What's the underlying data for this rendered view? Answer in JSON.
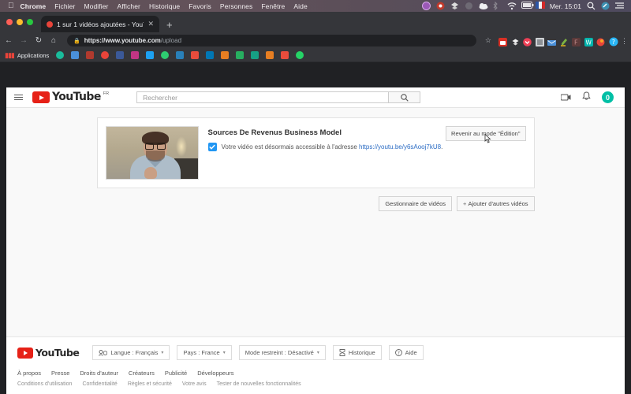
{
  "os_menubar": {
    "apple_icon": "apple-icon",
    "items": [
      "Chrome",
      "Fichier",
      "Modifier",
      "Afficher",
      "Historique",
      "Favoris",
      "Personnes",
      "Fenêtre",
      "Aide"
    ],
    "active_app": "Chrome",
    "clock": "Mer. 15:01",
    "tray_icons": [
      "purple-circle-icon",
      "record-icon",
      "dropbox-icon",
      "grey-circle-icon",
      "cloud-icon",
      "bluetooth-icon",
      "wifi-icon",
      "battery-icon",
      "flag-france-icon",
      "search-icon",
      "control-center-icon",
      "notification-center-icon"
    ],
    "background_color": "#5b4d55"
  },
  "browser": {
    "traffic_lights": [
      "close",
      "minimize",
      "zoom"
    ],
    "tab": {
      "title": "1 sur 1 vidéos ajoutées - YouTu",
      "favicon": "youtube-favicon",
      "close_icon": "close-icon"
    },
    "new_tab_label": "+",
    "nav": {
      "back_icon": "back-arrow-icon",
      "forward_icon": "forward-arrow-icon",
      "reload_icon": "reload-icon",
      "home_icon": "home-icon"
    },
    "omnibox": {
      "lock_icon": "lock-icon",
      "url_domain": "https://www.youtube.com",
      "url_path": "/upload",
      "star_icon": "bookmark-star-icon"
    },
    "extensions": [
      {
        "name": "lastpass-icon",
        "color": "#d93025"
      },
      {
        "name": "dropbox-icon",
        "color": "#ffffff"
      },
      {
        "name": "pocket-icon",
        "color": "#ef4056"
      },
      {
        "name": "grammarly-icon",
        "color": "#e8eaed"
      },
      {
        "name": "email-icon",
        "color": "#4a90d9"
      },
      {
        "name": "highlighter-icon",
        "color": "#7cb342"
      },
      {
        "name": "f-icon",
        "color": "#8b3a3a"
      },
      {
        "name": "w-icon",
        "color": "#00b5ad"
      },
      {
        "name": "red-orange-icon",
        "color": "#e8443a"
      },
      {
        "name": "help-icon",
        "color": "#29b6f6"
      }
    ],
    "menu_icon": "kebab-menu-icon",
    "bookmarks": {
      "apps_label": "Applications",
      "apps_icon": "apps-grid-icon",
      "items": [
        {
          "name": "bookmark-grammarly",
          "color": "#1abc9c"
        },
        {
          "name": "bookmark-mail",
          "color": "#4a90d9"
        },
        {
          "name": "bookmark-bank",
          "color": "#c0392b"
        },
        {
          "name": "bookmark-youtube",
          "color": "#e8443a"
        },
        {
          "name": "bookmark-facebook",
          "color": "#3b5998"
        },
        {
          "name": "bookmark-instagram",
          "color": "#c13584"
        },
        {
          "name": "bookmark-twitter",
          "color": "#1da1f2"
        },
        {
          "name": "bookmark-green",
          "color": "#2ecc71"
        },
        {
          "name": "bookmark-blue-folder",
          "color": "#2980b9"
        },
        {
          "name": "bookmark-red-pin",
          "color": "#e74c3c"
        },
        {
          "name": "bookmark-linkedin",
          "color": "#0077b5"
        },
        {
          "name": "bookmark-fire",
          "color": "#e67e22"
        },
        {
          "name": "bookmark-green-chart",
          "color": "#27ae60"
        },
        {
          "name": "bookmark-teal",
          "color": "#16a085"
        },
        {
          "name": "bookmark-orange-bars",
          "color": "#e67e22"
        },
        {
          "name": "bookmark-red-news",
          "color": "#e74c3c"
        },
        {
          "name": "bookmark-whatsapp",
          "color": "#25d366"
        }
      ]
    }
  },
  "youtube": {
    "header": {
      "menu_icon": "hamburger-icon",
      "logo_text": "YouTube",
      "logo_country": "FR",
      "search_placeholder": "Rechercher",
      "search_icon": "search-icon",
      "upload_icon": "video-camera-icon",
      "notifications_icon": "bell-icon",
      "avatar_initial": "0",
      "avatar_color": "#00bfa5"
    },
    "card": {
      "thumbnail_alt": "video-thumbnail",
      "title": "Sources De Revenus Business Model",
      "checkbox_icon": "checkmark-icon",
      "message_prefix": "Votre vidéo est désormais accessible à l'adresse ",
      "message_link": "https://youtu.be/y6sAooj7kU8",
      "message_suffix": ".",
      "edit_button": "Revenir au mode \"Édition\"",
      "cursor_icon": "pointer-cursor-icon"
    },
    "actions": {
      "video_manager": "Gestionnaire de vidéos",
      "add_more": "Ajouter d'autres vidéos",
      "add_more_icon": "plus-icon"
    },
    "footer": {
      "logo_text": "YouTube",
      "controls": [
        {
          "icon": "language-icon",
          "label": "Langue : Français",
          "caret": "▾"
        },
        {
          "icon": "",
          "label": "Pays : France",
          "caret": "▾"
        },
        {
          "icon": "",
          "label": "Mode restreint : Désactivé",
          "caret": "▾"
        },
        {
          "icon": "history-icon",
          "label": "Historique",
          "caret": ""
        },
        {
          "icon": "help-circle-icon",
          "label": "Aide",
          "caret": ""
        }
      ],
      "links_primary": [
        "À propos",
        "Presse",
        "Droits d'auteur",
        "Créateurs",
        "Publicité",
        "Développeurs"
      ],
      "links_secondary": [
        "Conditions d'utilisation",
        "Confidentialité",
        "Règles et sécurité",
        "Votre avis",
        "Tester de nouvelles fonctionnalités"
      ]
    }
  }
}
